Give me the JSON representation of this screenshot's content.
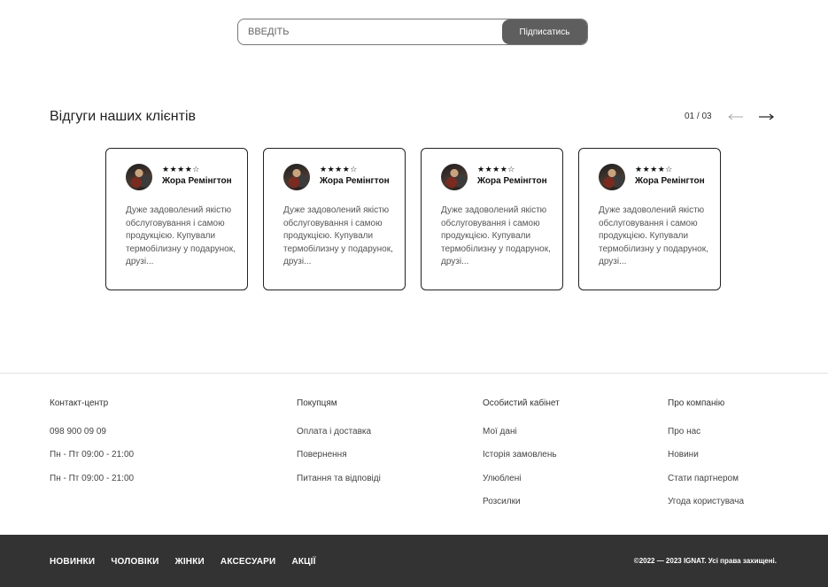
{
  "subscribe": {
    "placeholder": "ВВЕДІТЬ",
    "button_label": "Підписатись"
  },
  "reviews": {
    "title": "Відгуги наших клієнтів",
    "pager": "01 / 03",
    "prev_icon": "arrow-left-icon",
    "next_icon": "arrow-right-icon",
    "items": [
      {
        "rating": 4,
        "stars_text": "★★★★☆",
        "name": "Жора Ремінгтон",
        "text": "Дуже задоволений якістю обслуговування і самою продукцією. Купували термобілизну у подарунок, друзі..."
      },
      {
        "rating": 4,
        "stars_text": "★★★★☆",
        "name": "Жора Ремінгтон",
        "text": "Дуже задоволений якістю обслуговування і самою продукцією. Купували термобілизну у подарунок, друзі..."
      },
      {
        "rating": 4,
        "stars_text": "★★★★☆",
        "name": "Жора Ремінгтон",
        "text": "Дуже задоволений якістю обслуговування і самою продукцією. Купували термобілизну у подарунок, друзі..."
      },
      {
        "rating": 4,
        "stars_text": "★★★★☆",
        "name": "Жора Ремінгтон",
        "text": "Дуже задоволений якістю обслуговування і самою продукцією. Купували термобілизну у подарунок, друзі..."
      }
    ]
  },
  "footer": {
    "columns": [
      {
        "heading": "Контакт-центр",
        "links": [
          "098 900 09 09",
          "Пн - Пт 09:00 - 21:00",
          "Пн - Пт 09:00 - 21:00"
        ]
      },
      {
        "heading": "Покупцям",
        "links": [
          "Оплата і доставка",
          "Повернення",
          "Питання та відповіді"
        ]
      },
      {
        "heading": "Особистий кабінет",
        "links": [
          "Мої дані",
          "Історія замовлень",
          "Улюблені",
          "Розсилки"
        ]
      },
      {
        "heading": "Про компанію",
        "links": [
          "Про нас",
          "Новини",
          "Стати партнером",
          "Угода користувача"
        ]
      }
    ]
  },
  "bottom_bar": {
    "nav": [
      "НОВИНКИ",
      "ЧОЛОВІКИ",
      "ЖІНКИ",
      "АКСЕСУАРИ",
      "АКЦІЇ"
    ],
    "copyright": "©2022 — 2023 IGNAT. Усі права захищені."
  },
  "colors": {
    "button_bg": "#5e5e5e",
    "bottom_bar_bg": "#333333",
    "card_border": "#222222"
  }
}
